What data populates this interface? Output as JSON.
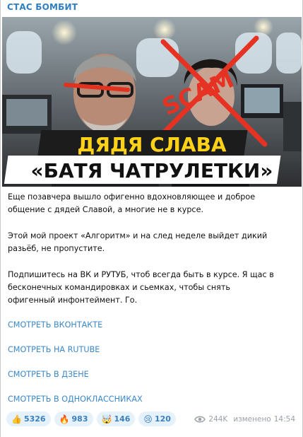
{
  "post": {
    "channel_name": "СТАС БОМБИТ",
    "preview": {
      "title_line1": "ДЯДЯ СЛАВА",
      "title_line2": "«БАТЯ ЧАТРУЛЕТКИ»",
      "stamp": "SCAM"
    },
    "paragraphs": [
      {
        "line1": "Еще позавчера вышло офигенно вдохновляющее и доброе",
        "line2": "общение с дядей Славой, а многие не в курсе."
      },
      {
        "line1": "Этой мой проект «Алгоритм» и на след неделе выйдет дикий",
        "line2": "разьёб, не пропустите."
      },
      {
        "line1": "Подпишитесь на ВК и РУТУБ, чтоб всегда быть в курсе. Я щас в",
        "line2": "бесконечных командировках и сьемках, чтобы снять",
        "line3": "офигенный инфонтеймент. Го."
      }
    ],
    "links": [
      "СМОТРЕТЬ ВКОНТАКТЕ",
      "СМОТРЕТЬ НА RUTUBE",
      "СМОТРЕТЬ В ДЗЕНЕ",
      "СМОТРЕТЬ В ОДНОКЛАССНИКАХ"
    ],
    "reactions": [
      {
        "emoji": "👍",
        "count": "5326"
      },
      {
        "emoji": "🔥",
        "count": "983"
      },
      {
        "emoji": "🤯",
        "count": "146"
      },
      {
        "emoji": "😢",
        "count": "120"
      }
    ],
    "views": "244K",
    "edited_label": "изменено",
    "time": "14:54"
  }
}
